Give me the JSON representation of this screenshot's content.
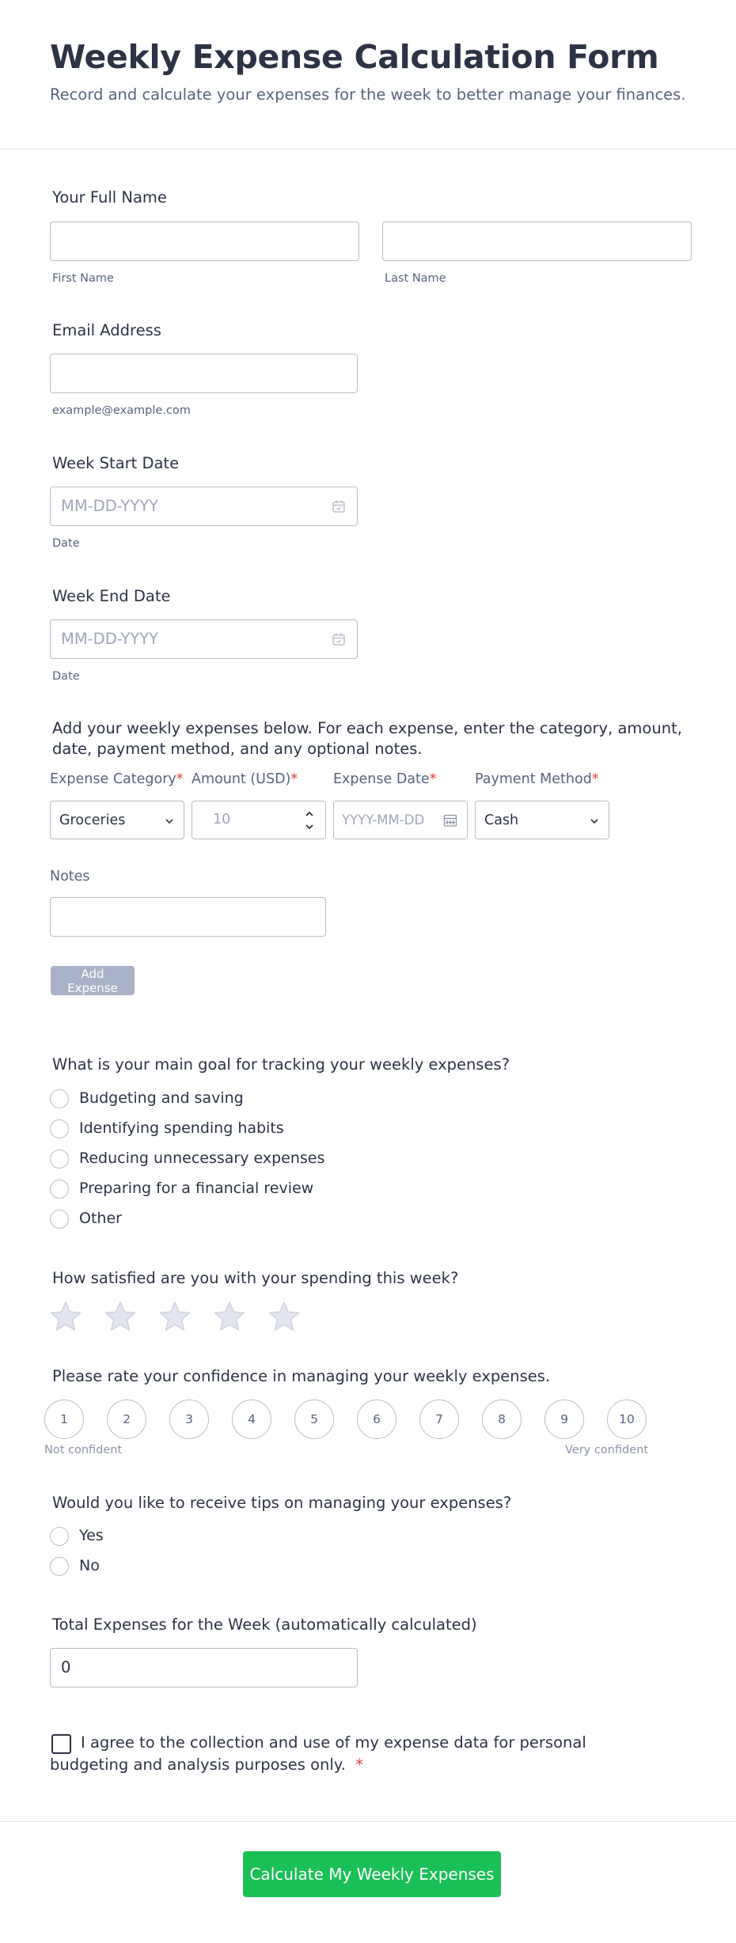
{
  "header": {
    "title": "Weekly Expense Calculation Form",
    "subtitle": "Record and calculate your expenses for the week to better manage your finances."
  },
  "full_name": {
    "label": "Your Full Name",
    "first_value": "",
    "first_sublabel": "First Name",
    "last_value": "",
    "last_sublabel": "Last Name"
  },
  "email": {
    "label": "Email Address",
    "value": "",
    "sublabel": "example@example.com"
  },
  "week_start": {
    "label": "Week Start Date",
    "placeholder": "MM-DD-YYYY",
    "sublabel": "Date"
  },
  "week_end": {
    "label": "Week End Date",
    "placeholder": "MM-DD-YYYY",
    "sublabel": "Date"
  },
  "expenses": {
    "instructions": "Add your weekly expenses below. For each expense, enter the category, amount, date, payment method, and any optional notes.",
    "category_label": "Expense Category",
    "category_value": "Groceries",
    "amount_label": "Amount (USD)",
    "amount_placeholder": "10",
    "date_label": "Expense Date",
    "date_placeholder": "YYYY-MM-DD",
    "payment_label": "Payment Method",
    "payment_value": "Cash",
    "required_mark": "*",
    "notes_label": "Notes",
    "notes_value": "",
    "add_button": "Add Expense"
  },
  "goal": {
    "question": "What is your main goal for tracking your weekly expenses?",
    "options": [
      "Budgeting and saving",
      "Identifying spending habits",
      "Reducing unnecessary expenses",
      "Preparing for a financial review",
      "Other"
    ]
  },
  "satisfaction": {
    "question": "How satisfied are you with your spending this week?",
    "rating": 0,
    "max": 5
  },
  "confidence": {
    "question": "Please rate your confidence in managing your weekly expenses.",
    "scale": [
      "1",
      "2",
      "3",
      "4",
      "5",
      "6",
      "7",
      "8",
      "9",
      "10"
    ],
    "low_label": "Not confident",
    "high_label": "Very confident"
  },
  "tips": {
    "question": "Would you like to receive tips on managing your expenses?",
    "options": [
      "Yes",
      "No"
    ]
  },
  "total": {
    "label": "Total Expenses for the Week (automatically calculated)",
    "value": "0"
  },
  "consent": {
    "text": "I agree to the collection and use of my expense data for personal budgeting and analysis purposes only.",
    "required_mark": "*"
  },
  "submit": {
    "label": "Calculate My Weekly Expenses"
  },
  "colors": {
    "accent_submit": "#1bbf57",
    "add_button": "#a9b2c8",
    "required": "#e33a3a",
    "text": "#2c3345",
    "muted": "#57647e"
  }
}
